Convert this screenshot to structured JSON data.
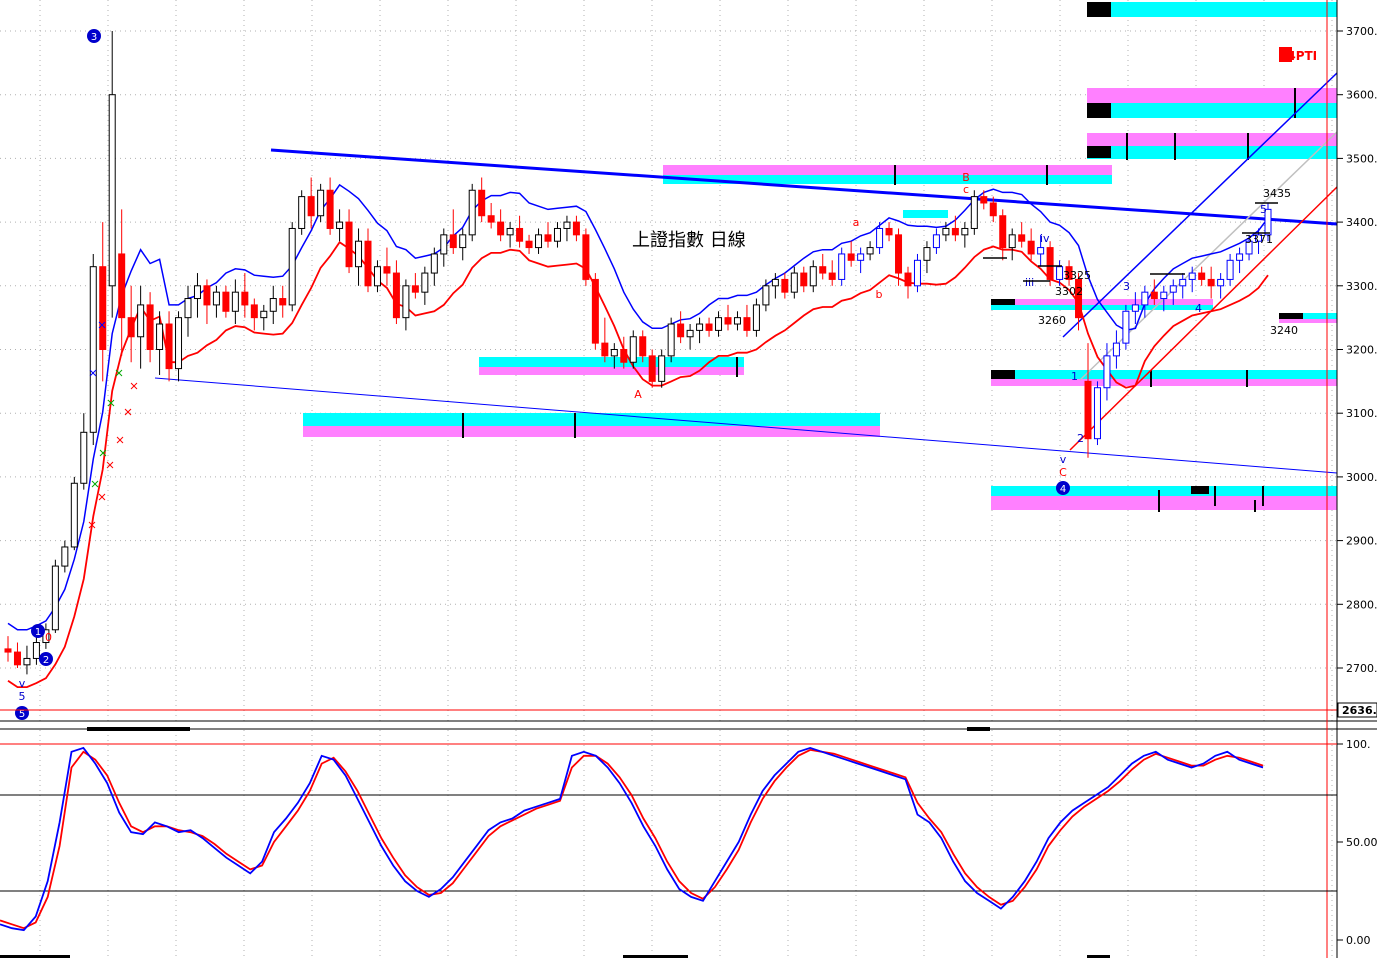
{
  "chart_data": {
    "type": "candlestick",
    "title": "上證指數 日線",
    "indicator_tag": "14PTI",
    "price_axis": {
      "ticks": [
        "3700.",
        "3600.",
        "3500.",
        "3400.",
        "3300.",
        "3200.",
        "3100.",
        "3000.",
        "2900.",
        "2800.",
        "2700."
      ],
      "values": [
        3700,
        3600,
        3500,
        3400,
        3300,
        3200,
        3100,
        3000,
        2900,
        2800,
        2700
      ],
      "current_marker": "2636.",
      "current_value": 2636,
      "ylim": [
        2636,
        3720
      ]
    },
    "oscillator_axis": {
      "ticks": [
        "100.",
        "50.00",
        "0.00"
      ],
      "values": [
        100,
        50,
        0
      ],
      "ylim": [
        0,
        100
      ]
    },
    "price_levels": [
      "3435",
      "3325",
      "3302",
      "3260",
      "3240",
      "3371"
    ],
    "wave_labels_circled": [
      "1",
      "2",
      "3",
      "4",
      "5"
    ],
    "wave_labels_red": [
      "A",
      "B",
      "C",
      "a",
      "b",
      "c",
      "v",
      "5"
    ],
    "wave_labels_blue": [
      "1",
      "2",
      "3",
      "4",
      "5",
      "iii",
      "iv"
    ],
    "candles": [
      [
        2730,
        2750,
        2710,
        2725
      ],
      [
        2725,
        2740,
        2700,
        2705
      ],
      [
        2705,
        2735,
        2690,
        2715
      ],
      [
        2715,
        2750,
        2705,
        2740
      ],
      [
        2740,
        2770,
        2730,
        2760
      ],
      [
        2760,
        2870,
        2755,
        2860
      ],
      [
        2860,
        2900,
        2850,
        2890
      ],
      [
        2890,
        3000,
        2885,
        2990
      ],
      [
        2990,
        3100,
        2980,
        3070
      ],
      [
        3070,
        3350,
        3050,
        3330
      ],
      [
        3330,
        3400,
        3150,
        3200
      ],
      [
        3300,
        3700,
        3250,
        3600
      ],
      [
        3350,
        3420,
        3190,
        3250
      ],
      [
        3250,
        3300,
        3180,
        3220
      ],
      [
        3220,
        3300,
        3170,
        3270
      ],
      [
        3270,
        3290,
        3180,
        3200
      ],
      [
        3200,
        3260,
        3160,
        3240
      ],
      [
        3240,
        3260,
        3150,
        3170
      ],
      [
        3170,
        3260,
        3150,
        3250
      ],
      [
        3250,
        3300,
        3220,
        3280
      ],
      [
        3280,
        3320,
        3250,
        3300
      ],
      [
        3300,
        3310,
        3240,
        3270
      ],
      [
        3270,
        3300,
        3250,
        3290
      ],
      [
        3290,
        3300,
        3250,
        3260
      ],
      [
        3260,
        3310,
        3240,
        3290
      ],
      [
        3290,
        3320,
        3250,
        3270
      ],
      [
        3270,
        3280,
        3230,
        3250
      ],
      [
        3250,
        3270,
        3230,
        3260
      ],
      [
        3260,
        3300,
        3240,
        3280
      ],
      [
        3280,
        3300,
        3250,
        3270
      ],
      [
        3270,
        3400,
        3260,
        3390
      ],
      [
        3390,
        3450,
        3380,
        3440
      ],
      [
        3440,
        3470,
        3390,
        3410
      ],
      [
        3410,
        3460,
        3400,
        3450
      ],
      [
        3450,
        3470,
        3380,
        3390
      ],
      [
        3390,
        3420,
        3370,
        3400
      ],
      [
        3400,
        3420,
        3320,
        3330
      ],
      [
        3330,
        3390,
        3300,
        3370
      ],
      [
        3370,
        3390,
        3290,
        3300
      ],
      [
        3300,
        3340,
        3290,
        3330
      ],
      [
        3330,
        3360,
        3300,
        3320
      ],
      [
        3320,
        3340,
        3240,
        3250
      ],
      [
        3250,
        3310,
        3230,
        3300
      ],
      [
        3300,
        3320,
        3280,
        3290
      ],
      [
        3290,
        3330,
        3270,
        3320
      ],
      [
        3320,
        3360,
        3300,
        3350
      ],
      [
        3350,
        3390,
        3330,
        3380
      ],
      [
        3380,
        3420,
        3350,
        3360
      ],
      [
        3360,
        3390,
        3340,
        3380
      ],
      [
        3380,
        3460,
        3370,
        3450
      ],
      [
        3450,
        3470,
        3400,
        3410
      ],
      [
        3410,
        3430,
        3390,
        3400
      ],
      [
        3400,
        3420,
        3370,
        3380
      ],
      [
        3380,
        3400,
        3360,
        3390
      ],
      [
        3390,
        3410,
        3360,
        3370
      ],
      [
        3370,
        3380,
        3350,
        3360
      ],
      [
        3360,
        3390,
        3350,
        3380
      ],
      [
        3380,
        3400,
        3360,
        3370
      ],
      [
        3370,
        3400,
        3360,
        3390
      ],
      [
        3390,
        3410,
        3370,
        3400
      ],
      [
        3400,
        3410,
        3370,
        3380
      ],
      [
        3380,
        3390,
        3300,
        3310
      ],
      [
        3310,
        3320,
        3200,
        3210
      ],
      [
        3210,
        3250,
        3180,
        3190
      ],
      [
        3190,
        3210,
        3170,
        3200
      ],
      [
        3200,
        3220,
        3170,
        3180
      ],
      [
        3180,
        3230,
        3170,
        3220
      ],
      [
        3220,
        3230,
        3180,
        3190
      ],
      [
        3190,
        3200,
        3140,
        3150
      ],
      [
        3150,
        3200,
        3140,
        3190
      ],
      [
        3190,
        3250,
        3180,
        3240
      ],
      [
        3240,
        3260,
        3210,
        3220
      ],
      [
        3220,
        3240,
        3200,
        3230
      ],
      [
        3230,
        3250,
        3210,
        3240
      ],
      [
        3240,
        3250,
        3220,
        3230
      ],
      [
        3230,
        3260,
        3220,
        3250
      ],
      [
        3250,
        3270,
        3230,
        3240
      ],
      [
        3240,
        3260,
        3230,
        3250
      ],
      [
        3250,
        3270,
        3220,
        3230
      ],
      [
        3230,
        3280,
        3220,
        3270
      ],
      [
        3270,
        3310,
        3260,
        3300
      ],
      [
        3300,
        3320,
        3280,
        3310
      ],
      [
        3310,
        3320,
        3280,
        3290
      ],
      [
        3290,
        3330,
        3280,
        3320
      ],
      [
        3320,
        3330,
        3290,
        3300
      ],
      [
        3300,
        3340,
        3290,
        3330
      ],
      [
        3330,
        3350,
        3310,
        3320
      ],
      [
        3320,
        3340,
        3300,
        3310
      ],
      [
        3310,
        3360,
        3300,
        3350
      ],
      [
        3350,
        3370,
        3330,
        3340
      ],
      [
        3340,
        3360,
        3320,
        3350
      ],
      [
        3350,
        3370,
        3340,
        3360
      ],
      [
        3360,
        3400,
        3350,
        3390
      ],
      [
        3390,
        3400,
        3370,
        3380
      ],
      [
        3380,
        3390,
        3300,
        3320
      ],
      [
        3320,
        3330,
        3280,
        3300
      ],
      [
        3300,
        3350,
        3290,
        3340
      ],
      [
        3340,
        3370,
        3320,
        3360
      ],
      [
        3360,
        3390,
        3350,
        3380
      ],
      [
        3380,
        3400,
        3370,
        3390
      ],
      [
        3390,
        3410,
        3370,
        3380
      ],
      [
        3380,
        3400,
        3360,
        3390
      ],
      [
        3390,
        3450,
        3380,
        3440
      ],
      [
        3440,
        3450,
        3420,
        3430
      ],
      [
        3430,
        3440,
        3400,
        3410
      ],
      [
        3410,
        3420,
        3340,
        3360
      ],
      [
        3360,
        3390,
        3340,
        3380
      ],
      [
        3380,
        3400,
        3360,
        3370
      ],
      [
        3370,
        3390,
        3340,
        3350
      ],
      [
        3350,
        3380,
        3330,
        3360
      ],
      [
        3360,
        3370,
        3300,
        3310
      ],
      [
        3310,
        3340,
        3300,
        3330
      ],
      [
        3330,
        3340,
        3300,
        3310
      ],
      [
        3310,
        3320,
        3230,
        3250
      ],
      [
        3150,
        3210,
        3030,
        3060
      ],
      [
        3060,
        3150,
        3050,
        3140
      ],
      [
        3140,
        3210,
        3120,
        3190
      ],
      [
        3190,
        3230,
        3170,
        3210
      ],
      [
        3210,
        3270,
        3200,
        3260
      ],
      [
        3260,
        3290,
        3240,
        3270
      ],
      [
        3270,
        3300,
        3250,
        3290
      ],
      [
        3290,
        3310,
        3270,
        3280
      ],
      [
        3280,
        3300,
        3260,
        3290
      ],
      [
        3290,
        3310,
        3270,
        3300
      ],
      [
        3300,
        3320,
        3280,
        3310
      ],
      [
        3310,
        3330,
        3290,
        3320
      ],
      [
        3320,
        3330,
        3300,
        3310
      ],
      [
        3310,
        3330,
        3280,
        3300
      ],
      [
        3300,
        3320,
        3280,
        3310
      ],
      [
        3310,
        3350,
        3300,
        3340
      ],
      [
        3340,
        3360,
        3320,
        3350
      ],
      [
        3350,
        3380,
        3340,
        3370
      ],
      [
        3370,
        3390,
        3350,
        3380
      ],
      [
        3380,
        3430,
        3370,
        3420
      ]
    ],
    "oscillator": {
      "fast": [
        8,
        6,
        5,
        12,
        30,
        60,
        96,
        98,
        90,
        80,
        65,
        55,
        54,
        60,
        58,
        55,
        56,
        52,
        47,
        42,
        38,
        34,
        40,
        55,
        62,
        70,
        80,
        94,
        92,
        84,
        72,
        60,
        48,
        38,
        30,
        25,
        22,
        26,
        32,
        40,
        48,
        56,
        60,
        62,
        66,
        68,
        70,
        72,
        94,
        96,
        94,
        88,
        80,
        70,
        58,
        48,
        36,
        26,
        22,
        20,
        30,
        40,
        50,
        64,
        76,
        84,
        90,
        96,
        98,
        96,
        94,
        92,
        90,
        88,
        86,
        84,
        82,
        64,
        60,
        52,
        40,
        30,
        24,
        20,
        16,
        22,
        30,
        40,
        52,
        60,
        66,
        70,
        74,
        78,
        84,
        90,
        94,
        96,
        92,
        90,
        88,
        90,
        94,
        96,
        92,
        90,
        88
      ],
      "slow": [
        10,
        8,
        6,
        9,
        22,
        48,
        88,
        96,
        92,
        84,
        70,
        58,
        55,
        58,
        58,
        56,
        55,
        53,
        49,
        44,
        40,
        36,
        38,
        50,
        58,
        66,
        76,
        90,
        93,
        86,
        76,
        64,
        52,
        42,
        33,
        27,
        23,
        24,
        29,
        37,
        45,
        53,
        58,
        61,
        64,
        67,
        69,
        71,
        88,
        94,
        94,
        90,
        83,
        74,
        62,
        52,
        40,
        30,
        24,
        21,
        27,
        36,
        46,
        60,
        72,
        81,
        88,
        94,
        97,
        96,
        95,
        93,
        91,
        89,
        87,
        85,
        83,
        70,
        62,
        55,
        44,
        34,
        27,
        22,
        18,
        20,
        27,
        36,
        48,
        56,
        63,
        68,
        72,
        76,
        81,
        87,
        92,
        95,
        93,
        91,
        89,
        89,
        92,
        94,
        93,
        91,
        89
      ]
    },
    "grid": true
  }
}
